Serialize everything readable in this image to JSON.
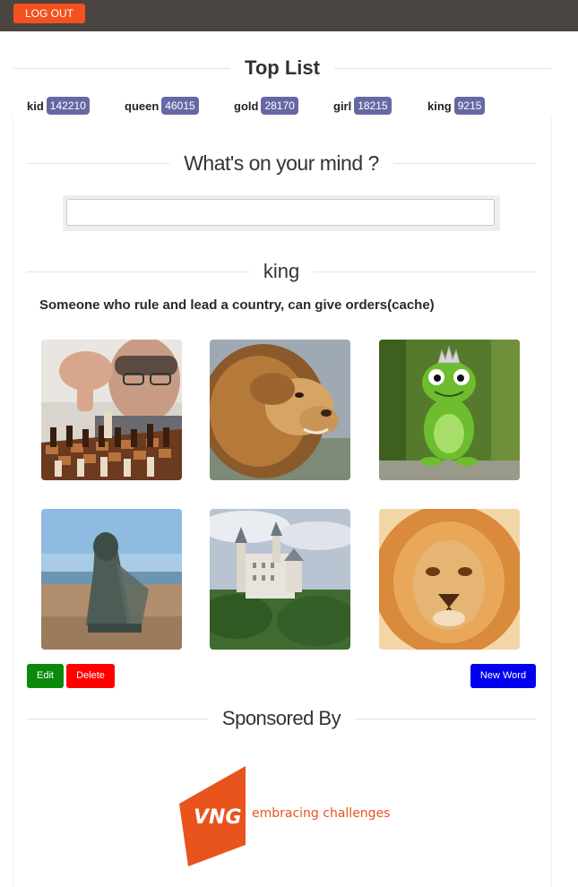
{
  "header": {
    "logout_label": "LOG OUT"
  },
  "top_list": {
    "title": "Top List",
    "items": [
      {
        "word": "kid",
        "count": "142210"
      },
      {
        "word": "queen",
        "count": "46015"
      },
      {
        "word": "gold",
        "count": "28170"
      },
      {
        "word": "girl",
        "count": "18215"
      },
      {
        "word": "king",
        "count": "9215"
      }
    ]
  },
  "mind": {
    "title": "What's on your mind ?",
    "input_value": "",
    "placeholder": ""
  },
  "word": {
    "title": "king",
    "definition": "Someone who rule and lead a country, can give orders(cache)",
    "images": [
      {
        "icon": "chess-player-photo"
      },
      {
        "icon": "lion-profile-photo"
      },
      {
        "icon": "frog-king-figurine-photo"
      },
      {
        "icon": "knight-statue-photo"
      },
      {
        "icon": "castle-photo"
      },
      {
        "icon": "lion-face-photo"
      }
    ]
  },
  "actions": {
    "edit_label": "Edit",
    "delete_label": "Delete",
    "new_word_label": "New Word"
  },
  "sponsor": {
    "title": "Sponsored By",
    "logo_text": "VNG",
    "tagline": "embracing challenges"
  },
  "colors": {
    "topbar": "#4a4541",
    "logout": "#f4511e",
    "badge": "#6668a4",
    "edit": "#0a8a0a",
    "delete": "#ff0000",
    "new_word": "#0000ee",
    "brand_orange": "#e8541c"
  }
}
